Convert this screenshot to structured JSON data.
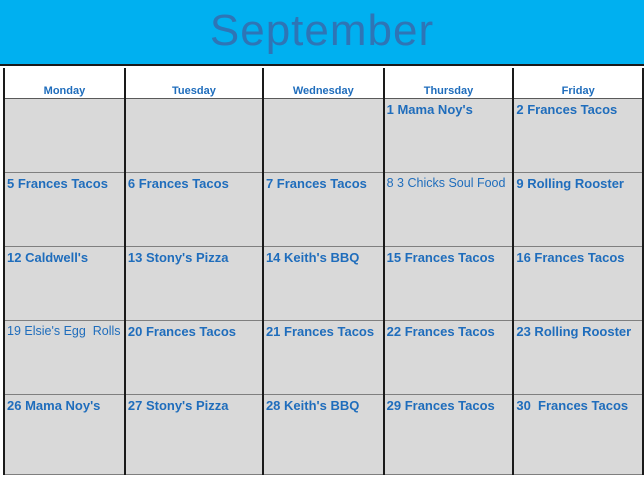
{
  "title": "September",
  "colors": {
    "banner": "#00b0f0",
    "title_text": "#2e75b6",
    "cell_text": "#1f6dbc",
    "cell_bg": "#d9d9d9"
  },
  "days": [
    "Monday",
    "Tuesday",
    "Wednesday",
    "Thursday",
    "Friday"
  ],
  "weeks": [
    [
      "",
      "",
      "",
      "1 Mama Noy's",
      "2 Frances Tacos"
    ],
    [
      "5 Frances Tacos",
      "6 Frances Tacos",
      "7 Frances Tacos",
      "8 3 Chicks Soul Food",
      "9 Rolling Rooster"
    ],
    [
      "12 Caldwell's",
      "13 Stony's Pizza",
      "14 Keith's BBQ",
      "15 Frances Tacos",
      "16 Frances Tacos"
    ],
    [
      "19 Elsie's Egg  Rolls",
      "20 Frances Tacos",
      "21 Frances Tacos",
      "22 Frances Tacos",
      "23 Rolling Rooster"
    ],
    [
      "26 Mama Noy's",
      "27 Stony's Pizza",
      "28 Keith's BBQ",
      "29 Frances Tacos",
      "30  Frances Tacos"
    ]
  ]
}
